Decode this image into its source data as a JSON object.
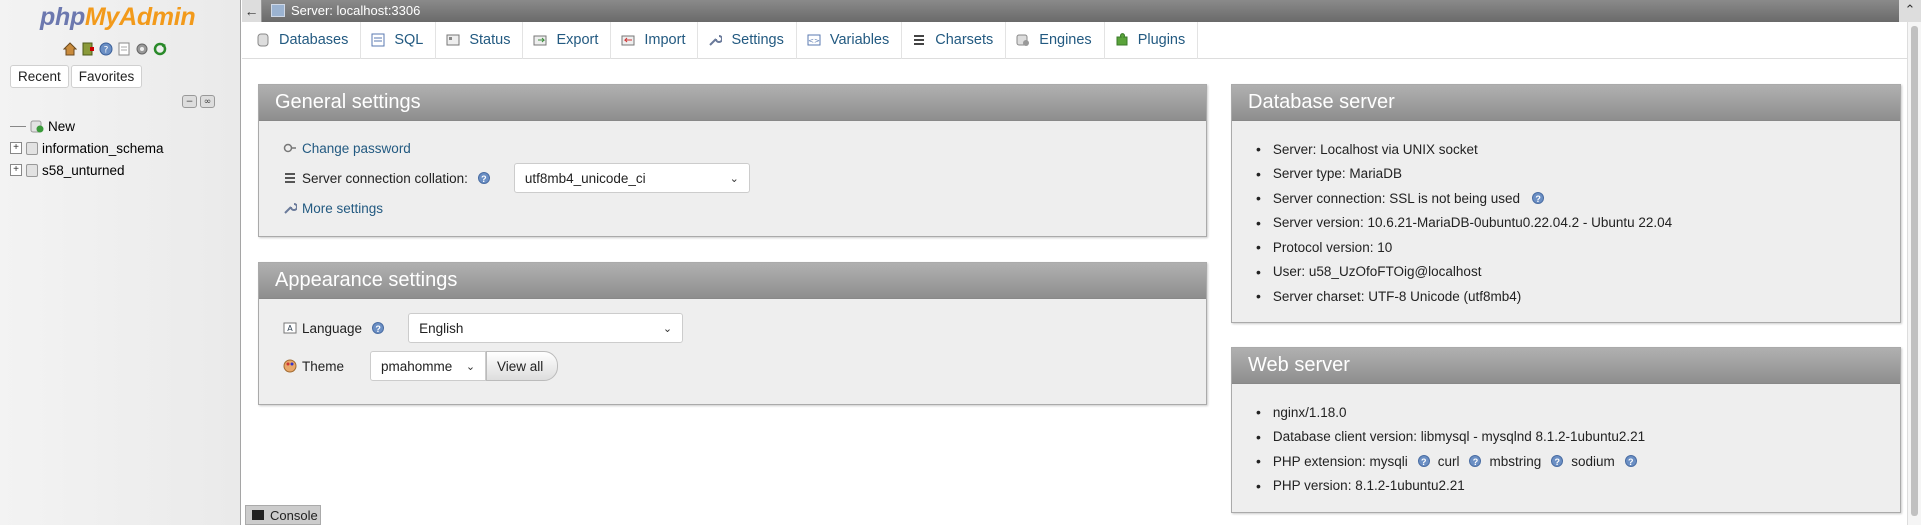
{
  "nav": {
    "logo": {
      "php": "php",
      "my": "My",
      "admin": "Admin"
    },
    "tabs": [
      "Recent",
      "Favorites"
    ],
    "tree": [
      {
        "label": "New",
        "kind": "new"
      },
      {
        "label": "information_schema",
        "kind": "db"
      },
      {
        "label": "s58_unturned",
        "kind": "db"
      }
    ]
  },
  "topbar": {
    "title": "Server: localhost:3306"
  },
  "menu": [
    {
      "label": "Databases",
      "icon": "database-icon"
    },
    {
      "label": "SQL",
      "icon": "sql-icon"
    },
    {
      "label": "Status",
      "icon": "status-icon"
    },
    {
      "label": "Export",
      "icon": "export-icon"
    },
    {
      "label": "Import",
      "icon": "import-icon"
    },
    {
      "label": "Settings",
      "icon": "wrench-icon"
    },
    {
      "label": "Variables",
      "icon": "variables-icon"
    },
    {
      "label": "Charsets",
      "icon": "charsets-icon"
    },
    {
      "label": "Engines",
      "icon": "engines-icon"
    },
    {
      "label": "Plugins",
      "icon": "puzzle-icon"
    }
  ],
  "general": {
    "title": "General settings",
    "change_password": "Change password",
    "collation_label": "Server connection collation:",
    "collation_value": "utf8mb4_unicode_ci",
    "more_settings": "More settings"
  },
  "appearance": {
    "title": "Appearance settings",
    "language_label": "Language",
    "language_value": "English",
    "theme_label": "Theme",
    "theme_value": "pmahomme",
    "view_all": "View all"
  },
  "dbserver": {
    "title": "Database server",
    "items": [
      "Server: Localhost via UNIX socket",
      "Server type: MariaDB",
      "Server connection: SSL is not being used",
      "Server version: 10.6.21-MariaDB-0ubuntu0.22.04.2 - Ubuntu 22.04",
      "Protocol version: 10",
      "User: u58_UzOfoFTOig@localhost",
      "Server charset: UTF-8 Unicode (utf8mb4)"
    ]
  },
  "webserver": {
    "title": "Web server",
    "nginx": "nginx/1.18.0",
    "client": "Database client version: libmysql - mysqlnd 8.1.2-1ubuntu2.21",
    "php_ext_label": "PHP extension: mysqli",
    "ext_curl": "curl",
    "ext_mbstring": "mbstring",
    "ext_sodium": "sodium",
    "php_version": "PHP version: 8.1.2-1ubuntu2.21"
  },
  "console": {
    "label": "Console"
  },
  "colors": {
    "link": "#235a81",
    "header_grad_top": "#b0b0b0",
    "header_grad_bottom": "#8e8e8e",
    "logo_blue": "#6c78af",
    "logo_orange": "#f29a1b"
  }
}
